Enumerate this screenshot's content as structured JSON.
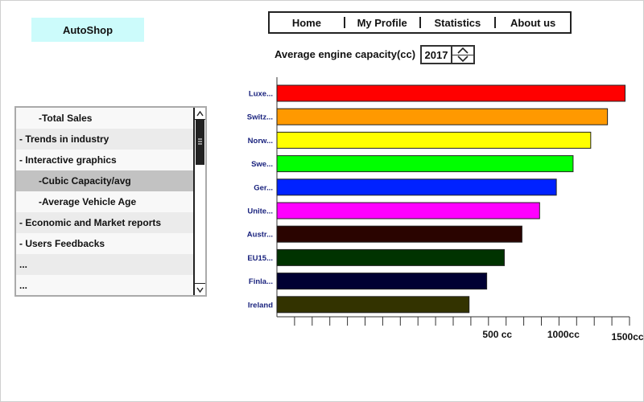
{
  "app": {
    "logo_label": "AutoShop"
  },
  "nav": {
    "items": [
      {
        "label": "Home"
      },
      {
        "label": "My Profile"
      },
      {
        "label": "Statistics"
      },
      {
        "label": "About us"
      }
    ]
  },
  "chart_header": {
    "title": "Average engine capacity(cc)",
    "year_value": "2017"
  },
  "sidebar": {
    "items": [
      {
        "label": "-Total Sales",
        "level": 2
      },
      {
        "label": "- Trends in industry",
        "level": 1
      },
      {
        "label": "- Interactive graphics",
        "level": 1
      },
      {
        "label": "-Cubic Capacity/avg",
        "level": 2,
        "selected": true
      },
      {
        "label": "-Average Vehicle Age",
        "level": 2
      },
      {
        "label": "- Economic and Market reports",
        "level": 1
      },
      {
        "label": "- Users Feedbacks",
        "level": 1
      },
      {
        "label": "...",
        "level": 1
      },
      {
        "label": "...",
        "level": 1
      }
    ]
  },
  "icons": {
    "stepper_up": "chevron-up-icon",
    "stepper_down": "chevron-down-icon",
    "scroll_up": "scroll-up-icon",
    "scroll_down": "scroll-down-icon"
  },
  "colors": {
    "logo_bg": "#ccfbfb",
    "selected_item_bg": "#c2c2c2",
    "category_label": "#1a237e"
  },
  "chart_data": {
    "type": "bar",
    "orientation": "horizontal",
    "title": "Average engine capacity(cc)",
    "categories": [
      "Luxe...",
      "Switz...",
      "Norw...",
      "Swe...",
      "Ger...",
      "Unite...",
      "Austr...",
      "EU15...",
      "Finla...",
      "Ireland"
    ],
    "values": [
      1975,
      1875,
      1780,
      1680,
      1585,
      1490,
      1390,
      1290,
      1190,
      1090
    ],
    "colors": [
      "#ff0000",
      "#ff9900",
      "#ffff00",
      "#00ff00",
      "#0022ff",
      "#ff00ff",
      "#2a0400",
      "#003300",
      "#000033",
      "#333300"
    ],
    "tick_labels": [
      {
        "label": "500 cc",
        "value": 1250
      },
      {
        "label": "1000cc",
        "value": 1625
      },
      {
        "label": "1500cc",
        "value": 1975
      }
    ],
    "xlim": [
      0,
      2000
    ],
    "minor_tick_step": 100,
    "grid": false
  }
}
